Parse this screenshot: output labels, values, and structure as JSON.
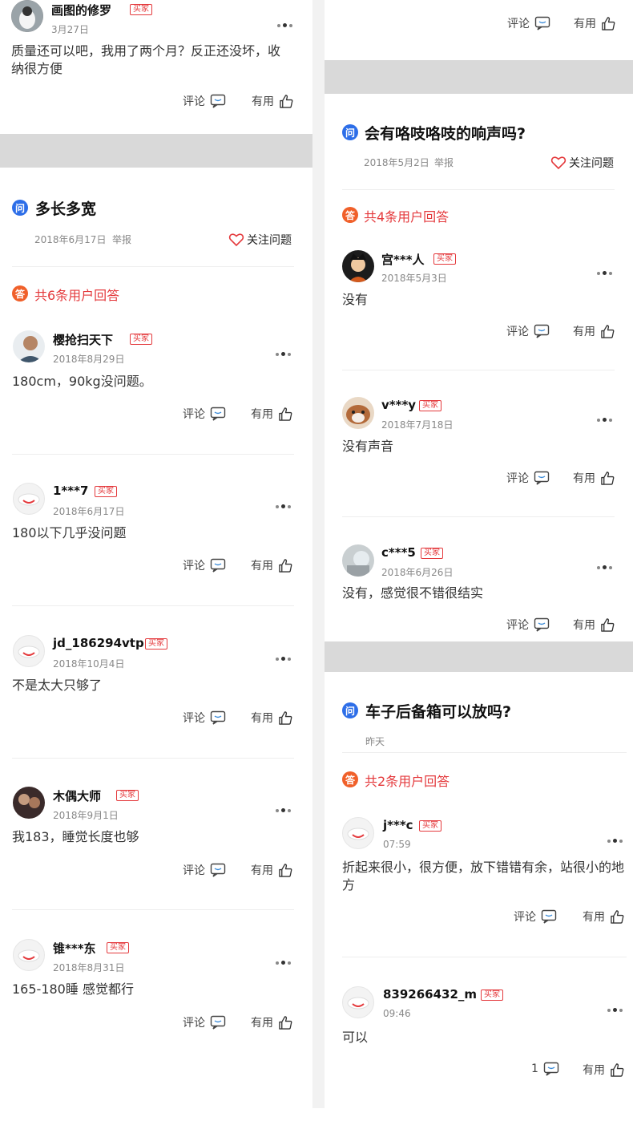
{
  "common": {
    "comment_label": "评论",
    "useful_label": "有用",
    "follow_label": "关注问题",
    "buyer_badge": "买家",
    "q_glyph": "问",
    "a_glyph": "答"
  },
  "colors": {
    "accent_red": "#e4393c",
    "question_blue": "#2d6ee8",
    "answer_orange": "#f0602a",
    "divider_gray": "#d9d9d9"
  },
  "left": {
    "top_answer": {
      "name": "画图的修罗",
      "date": "3月27日",
      "text": "质量还可以吧，我用了两个月？反正还没坏，收纳很方便"
    },
    "question": {
      "title": "多长多宽",
      "date": "2018年6月17日",
      "report": "举报",
      "answer_count": "共6条用户回答"
    },
    "answers": [
      {
        "name": "樱抢扫天下",
        "date": "2018年8月29日",
        "text": "180cm，90kg没问题。"
      },
      {
        "name": "1***7",
        "date": "2018年6月17日",
        "text": "180以下几乎没问题"
      },
      {
        "name": "jd_186294vtp",
        "date": "2018年10月4日",
        "text": "不是太大只够了"
      },
      {
        "name": "木偶大师",
        "date": "2018年9月1日",
        "text": "我183，睡觉长度也够"
      },
      {
        "name": "锥***东",
        "date": "2018年8月31日",
        "text": "165-180睡 感觉都行"
      }
    ]
  },
  "right": {
    "question1": {
      "title": "会有咯吱咯吱的响声吗?",
      "date": "2018年5月2日",
      "report": "举报",
      "answer_count": "共4条用户回答"
    },
    "answers1": [
      {
        "name": "宫***人",
        "date": "2018年5月3日",
        "text": "没有"
      },
      {
        "name": "v***y",
        "date": "2018年7月18日",
        "text": "没有声音"
      },
      {
        "name": "c***5",
        "date": "2018年6月26日",
        "text": "没有，感觉很不错很结实"
      }
    ],
    "question2": {
      "title": "车子后备箱可以放吗?",
      "date": "昨天",
      "answer_count": "共2条用户回答"
    },
    "answers2": [
      {
        "name": "j***c",
        "date": "07:59",
        "text": "折起来很小，很方便，放下错错有余，站很小的地方"
      },
      {
        "name": "839266432_m",
        "date": "09:46",
        "text": "可以",
        "comment_count": "1"
      }
    ]
  }
}
